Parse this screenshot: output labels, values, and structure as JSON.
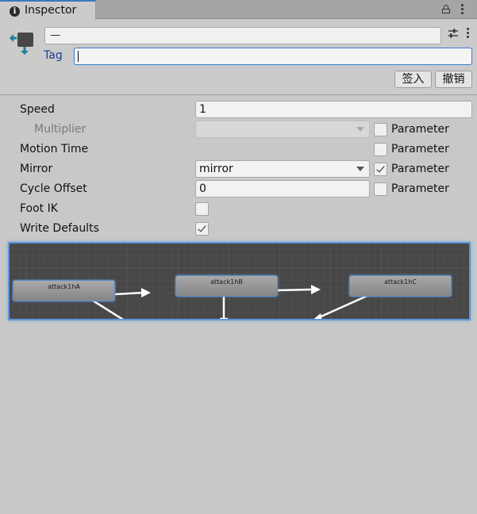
{
  "tab": {
    "title": "Inspector",
    "info_icon": "i"
  },
  "header": {
    "name_value": "—",
    "tag_label": "Tag",
    "tag_value": "",
    "sign_in_label": "签入",
    "undo_label": "撤销"
  },
  "properties": {
    "parameter_label": "Parameter",
    "speed": {
      "label": "Speed",
      "value": "1"
    },
    "multiplier": {
      "label": "Multiplier",
      "value": "",
      "parameter_checked": false
    },
    "motion_time": {
      "label": "Motion Time",
      "parameter_checked": false
    },
    "mirror": {
      "label": "Mirror",
      "value": "mirror",
      "parameter_checked": true
    },
    "cycle_offset": {
      "label": "Cycle Offset",
      "value": "0",
      "parameter_checked": false
    },
    "foot_ik": {
      "label": "Foot IK",
      "checked": false
    },
    "write_defaults": {
      "label": "Write Defaults",
      "checked": true
    }
  },
  "graph": {
    "nodes": [
      "attack1hA",
      "attack1hB",
      "attack1hC"
    ]
  },
  "colors": {
    "accent": "#3a7bd5",
    "background": "#c8c8c8",
    "graph_bg": "#474747"
  }
}
